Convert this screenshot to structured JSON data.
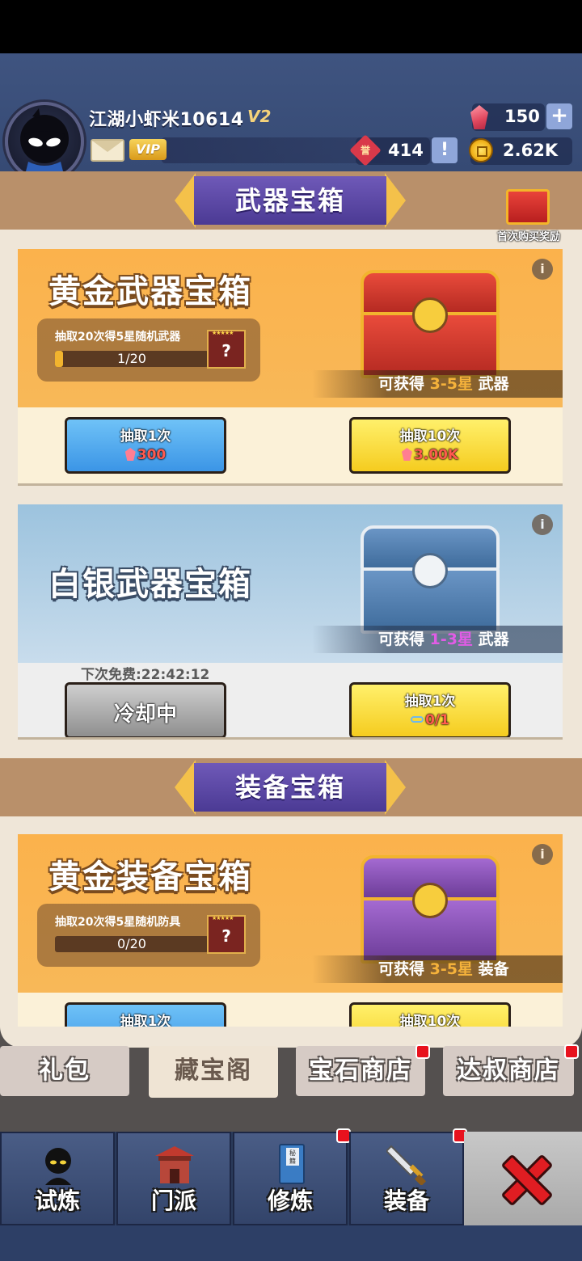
{
  "header": {
    "username": "江湖小虾米10614",
    "v_level": "V2",
    "vip_label": "VIP",
    "gems": "150",
    "honor": "414",
    "coins": "2.62K",
    "plus_label": "+",
    "alert_label": "!",
    "honor_glyph": "誉"
  },
  "first_purchase": {
    "label": "首次购买奖励"
  },
  "sections": {
    "weapon": "武器宝箱",
    "equipment": "装备宝箱"
  },
  "cards": {
    "gold_weapon": {
      "title": "黄金武器宝箱",
      "progress_text": "抽取20次得5星随机武器",
      "progress": "1/20",
      "progress_fraction": 0.05,
      "gain_prefix": "可获得",
      "gain_stars": "3-5星",
      "gain_type": "武器",
      "btn1_label": "抽取1次",
      "btn1_price": "300",
      "btn10_label": "抽取10次",
      "btn10_price": "3.00K"
    },
    "silver_weapon": {
      "title": "白银武器宝箱",
      "gain_prefix": "可获得",
      "gain_stars": "1-3星",
      "gain_type": "武器",
      "free_time": "下次免费:22:42:12",
      "cooldown_label": "冷却中",
      "btn1_label": "抽取1次",
      "btn1_keys": "0/1"
    },
    "gold_equip": {
      "title": "黄金装备宝箱",
      "progress_text": "抽取20次得5星随机防具",
      "progress": "0/20",
      "progress_fraction": 0,
      "gain_prefix": "可获得",
      "gain_stars": "3-5星",
      "gain_type": "装备",
      "btn1_label": "抽取1次",
      "btn10_label": "抽取10次"
    }
  },
  "info_glyph": "i",
  "reward_glyph": "?",
  "tabs": [
    {
      "label": "礼包",
      "active": false,
      "badge": false
    },
    {
      "label": "藏宝阁",
      "active": true,
      "badge": false
    },
    {
      "label": "宝石商店",
      "active": false,
      "badge": true
    },
    {
      "label": "达叔商店",
      "active": false,
      "badge": true
    }
  ],
  "nav": [
    {
      "label": "试炼",
      "icon": "ninja-icon",
      "badge": false
    },
    {
      "label": "门派",
      "icon": "temple-icon",
      "badge": false
    },
    {
      "label": "修炼",
      "icon": "book-icon",
      "badge": true,
      "book_text": "秘籍"
    },
    {
      "label": "装备",
      "icon": "sword-icon",
      "badge": true
    },
    {
      "label": "",
      "icon": "close-icon",
      "badge": false
    }
  ],
  "colors": {
    "gold_card": "#fbb24c",
    "silver_card": "#9cc3de",
    "banner_purple": "#5b47a6",
    "star_orange": "#f5b23b",
    "star_purple": "#e15ce6"
  }
}
